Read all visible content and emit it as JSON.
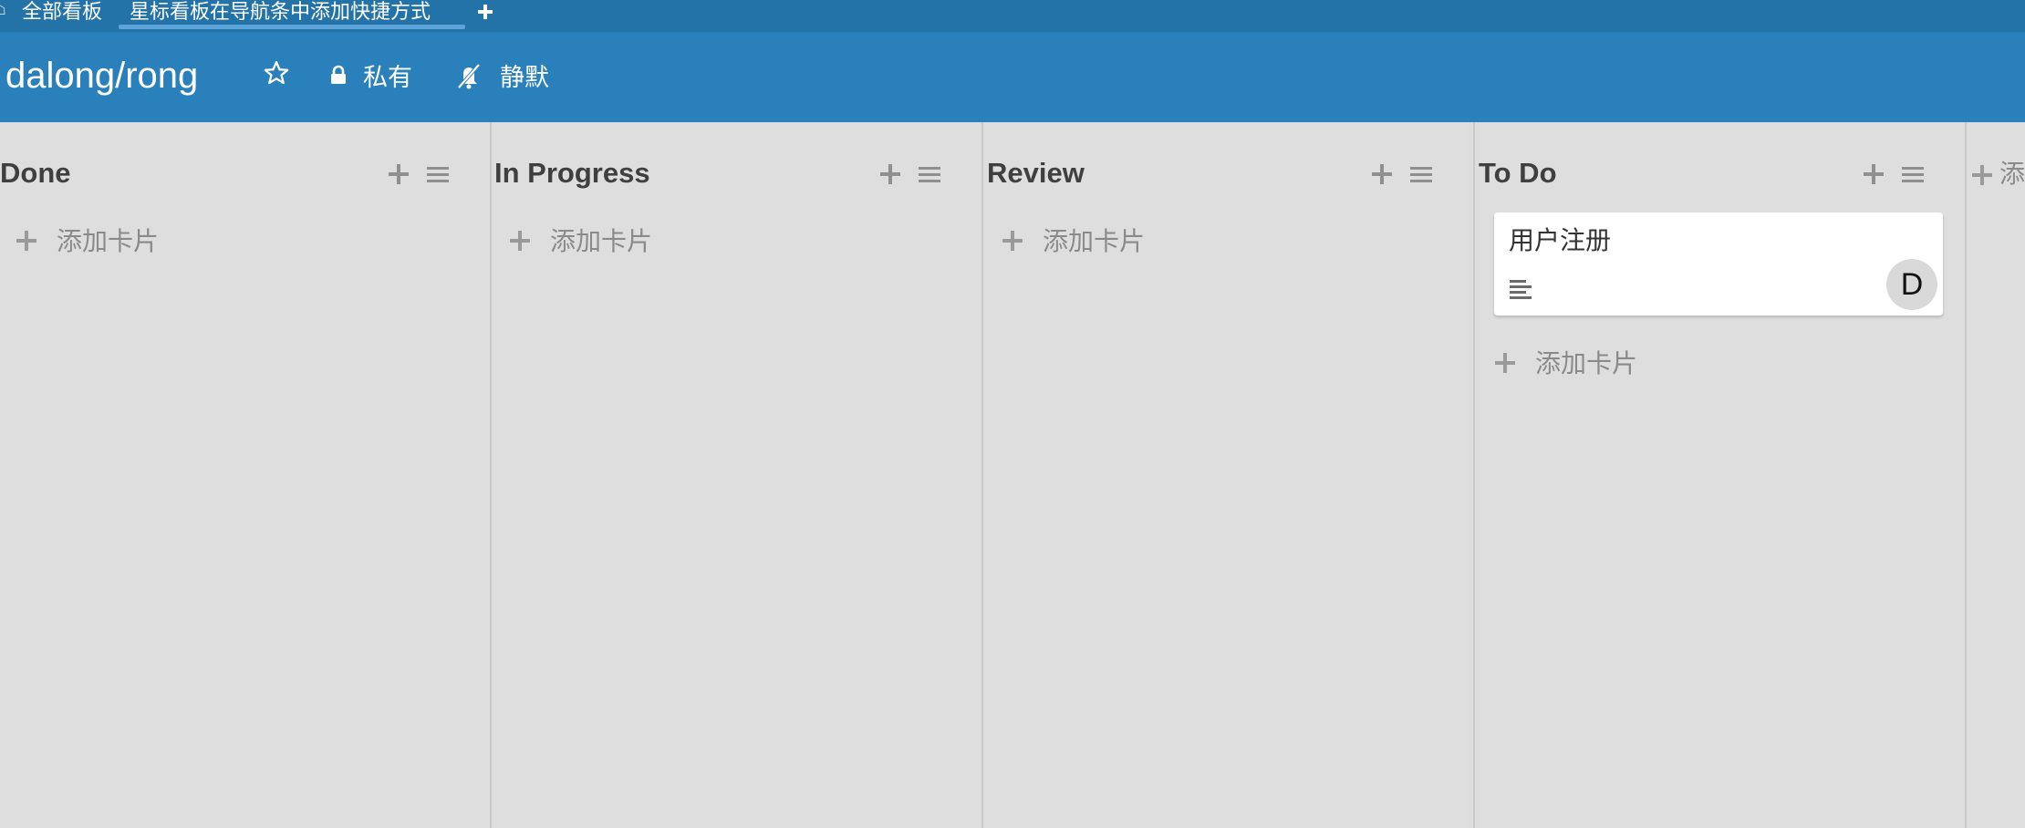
{
  "tabs": {
    "all_boards": "全部看板",
    "active": "星标看板在导航条中添加快捷方式"
  },
  "header": {
    "board_title": "dalong/rong",
    "private_label": "私有",
    "mute_label": "静默"
  },
  "lists": [
    {
      "title": "Done",
      "add_card_label": "添加卡片"
    },
    {
      "title": "In Progress",
      "add_card_label": "添加卡片"
    },
    {
      "title": "Review",
      "add_card_label": "添加卡片"
    },
    {
      "title": "To Do",
      "add_card_label": "添加卡片",
      "cards": [
        {
          "title": "用户注册",
          "avatar_initial": "D"
        }
      ]
    }
  ],
  "add_list_label": "添",
  "icons": [
    "home-icon",
    "plus-icon",
    "star-icon",
    "lock-icon",
    "mute-icon",
    "menu-icon",
    "description-icon"
  ],
  "colors": {
    "tabbar": "#2373a9",
    "header": "#2a80bb",
    "board_bg": "#dedede",
    "tab_underline": "#5ba3d9"
  }
}
